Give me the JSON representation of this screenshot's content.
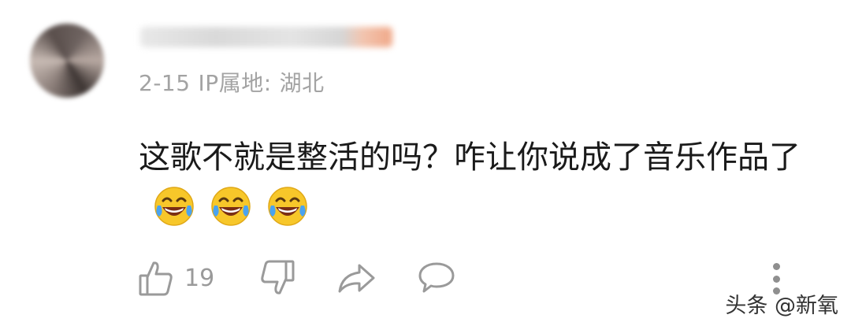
{
  "comment": {
    "date": "2-15",
    "ip_label": "IP属地:",
    "ip_location": "湖北",
    "text": "这歌不就是整活的吗？咋让你说成了音乐作品了",
    "emojis": [
      "laugh-cry-icon",
      "laugh-cry-icon",
      "laugh-cry-icon"
    ]
  },
  "actions": {
    "like_count": "19",
    "icons": [
      "thumbs-up-icon",
      "thumbs-down-icon",
      "share-icon",
      "reply-icon",
      "more-icon"
    ]
  },
  "watermark": "头条 @新氧",
  "colors": {
    "meta_text": "#a3a3a3",
    "icon_gray": "#9a9a9a",
    "emoji_face": "#f7c72a",
    "emoji_tear": "#4aa3f0"
  }
}
